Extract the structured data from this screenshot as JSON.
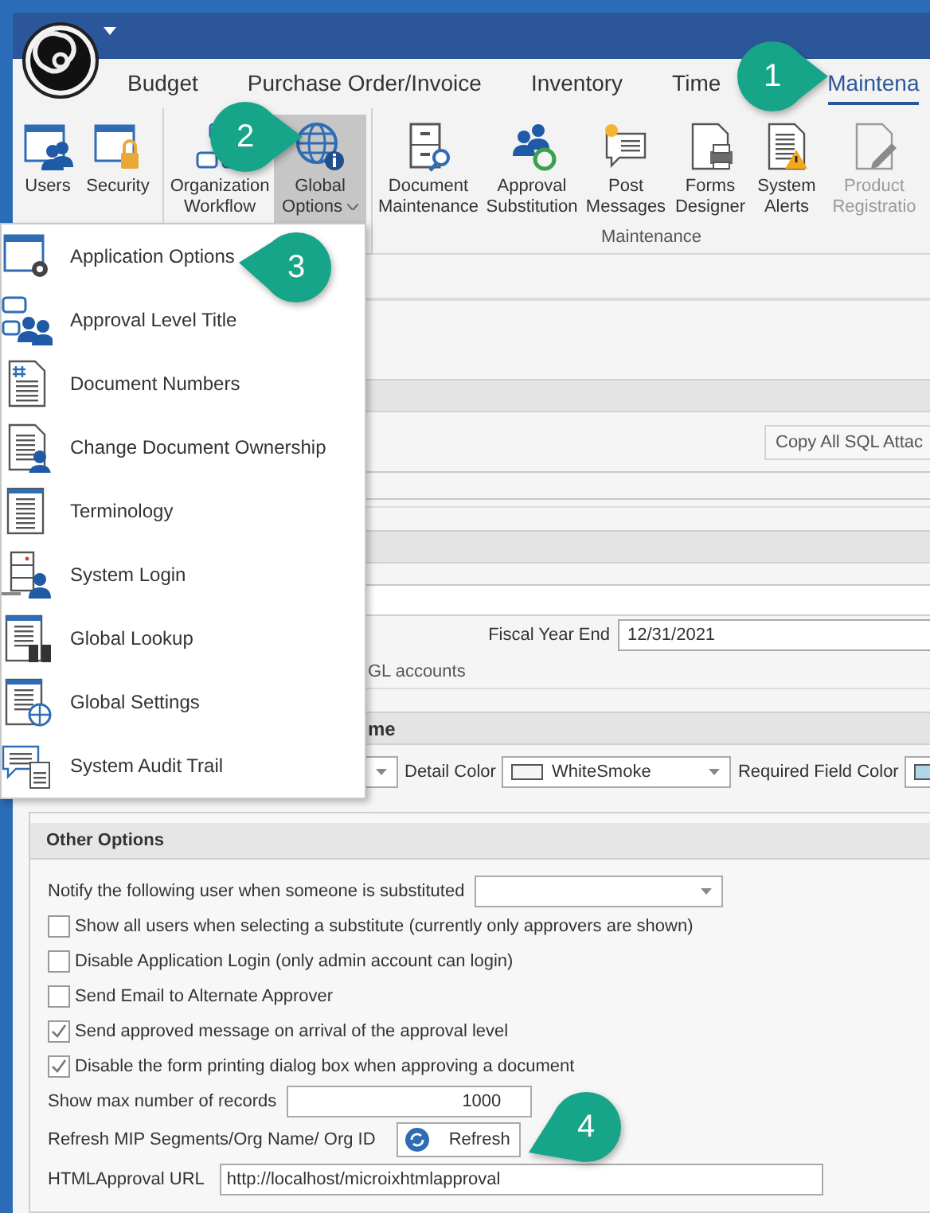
{
  "tabs": [
    {
      "label": "Budget",
      "selected": false
    },
    {
      "label": "Purchase Order/Invoice",
      "selected": false
    },
    {
      "label": "Inventory",
      "selected": false
    },
    {
      "label": "Time",
      "selected": false
    },
    {
      "label": "Maintena",
      "selected": true
    }
  ],
  "ribbon_groups": [
    {
      "buttons": [
        {
          "label": "Users",
          "pressed": false,
          "disabled": false,
          "dropdown": false
        },
        {
          "label": "Security",
          "pressed": false,
          "disabled": false,
          "dropdown": false
        }
      ]
    },
    {
      "buttons": [
        {
          "label": "Organization Workflow",
          "pressed": false,
          "disabled": false,
          "dropdown": false
        },
        {
          "label": "Global Options",
          "pressed": true,
          "disabled": false,
          "dropdown": true
        }
      ]
    },
    {
      "label": "Maintenance",
      "buttons": [
        {
          "label": "Document Maintenance",
          "pressed": false,
          "disabled": false,
          "dropdown": false
        },
        {
          "label": "Approval Substitution",
          "pressed": false,
          "disabled": false,
          "dropdown": false
        },
        {
          "label": "Post Messages",
          "pressed": false,
          "disabled": false,
          "dropdown": false
        },
        {
          "label": "Forms Designer",
          "pressed": false,
          "disabled": false,
          "dropdown": false
        },
        {
          "label": "System Alerts",
          "pressed": false,
          "disabled": false,
          "dropdown": false
        },
        {
          "label": "Product Registratio",
          "pressed": false,
          "disabled": true,
          "dropdown": false
        }
      ]
    }
  ],
  "global_options_menu": [
    {
      "label": "Application Options"
    },
    {
      "label": "Approval Level Title"
    },
    {
      "label": "Document Numbers"
    },
    {
      "label": "Change Document Ownership"
    },
    {
      "label": "Terminology"
    },
    {
      "label": "System Login"
    },
    {
      "label": "Global Lookup"
    },
    {
      "label": "Global Settings"
    },
    {
      "label": "System Audit Trail"
    }
  ],
  "background_form": {
    "copy_button": "Copy All SQL Attac",
    "fiscal_year_end": {
      "label": "Fiscal Year End",
      "value": "12/31/2021"
    },
    "gl_note": "GL accounts",
    "section_heading": "me",
    "colors": [
      {
        "label": "Detail Color",
        "value": "WhiteSmoke",
        "color": "#f5f5f5"
      },
      {
        "label": "Required Field Color",
        "color": "#add8e6"
      }
    ]
  },
  "other_options": {
    "title": "Other Options",
    "rows": [
      {
        "kind": "combo",
        "label": "Notify the following user when someone is substituted"
      },
      {
        "kind": "checkbox",
        "label": "Show all users when selecting a substitute (currently only approvers are shown)",
        "checked": false
      },
      {
        "kind": "checkbox",
        "label": "Disable Application Login (only admin account can login)",
        "checked": false
      },
      {
        "kind": "checkbox",
        "label": "Send Email to Alternate Approver",
        "checked": false
      },
      {
        "kind": "checkbox",
        "label": "Send approved message on arrival of the approval level",
        "checked": true
      },
      {
        "kind": "checkbox",
        "label": "Disable the form printing dialog box when approving a document",
        "checked": true
      },
      {
        "kind": "spin",
        "label": "Show max number of records",
        "value": "1000"
      },
      {
        "kind": "button",
        "label": "Refresh MIP Segments/Org Name/ Org ID",
        "button": "Refresh"
      },
      {
        "kind": "text",
        "label": "HTMLApproval URL",
        "value": "http://localhost/microixhtmlapproval"
      }
    ]
  },
  "callouts": [
    {
      "number": "1"
    },
    {
      "number": "2"
    },
    {
      "number": "3"
    },
    {
      "number": "4"
    }
  ]
}
